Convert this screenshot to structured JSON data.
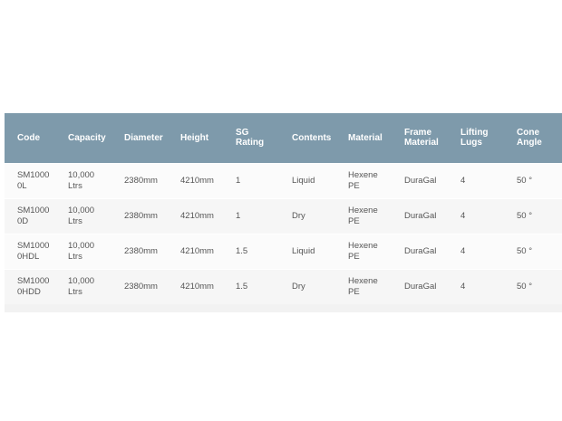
{
  "table": {
    "headers": [
      [
        "Code"
      ],
      [
        "Capacity"
      ],
      [
        "Diameter"
      ],
      [
        "Height"
      ],
      [
        "SG",
        "Rating"
      ],
      [
        "Contents"
      ],
      [
        "Material"
      ],
      [
        "Frame",
        "Material"
      ],
      [
        "Lifting",
        "Lugs"
      ],
      [
        "Cone",
        "Angle"
      ]
    ],
    "rows": [
      [
        [
          "SM1000",
          "0L"
        ],
        [
          "10,000",
          "Ltrs"
        ],
        [
          "2380mm"
        ],
        [
          "4210mm"
        ],
        [
          "1"
        ],
        [
          "Liquid"
        ],
        [
          "Hexene",
          "PE"
        ],
        [
          "DuraGal"
        ],
        [
          "4"
        ],
        [
          "50 °"
        ]
      ],
      [
        [
          "SM1000",
          "0D"
        ],
        [
          "10,000",
          "Ltrs"
        ],
        [
          "2380mm"
        ],
        [
          "4210mm"
        ],
        [
          "1"
        ],
        [
          "Dry"
        ],
        [
          "Hexene",
          "PE"
        ],
        [
          "DuraGal"
        ],
        [
          "4"
        ],
        [
          "50 °"
        ]
      ],
      [
        [
          "SM1000",
          "0HDL"
        ],
        [
          "10,000",
          "Ltrs"
        ],
        [
          "2380mm"
        ],
        [
          "4210mm"
        ],
        [
          "1.5"
        ],
        [
          "Liquid"
        ],
        [
          "Hexene",
          "PE"
        ],
        [
          "DuraGal"
        ],
        [
          "4"
        ],
        [
          "50 °"
        ]
      ],
      [
        [
          "SM1000",
          "0HDD"
        ],
        [
          "10,000",
          "Ltrs"
        ],
        [
          "2380mm"
        ],
        [
          "4210mm"
        ],
        [
          "1.5"
        ],
        [
          "Dry"
        ],
        [
          "Hexene",
          "PE"
        ],
        [
          "DuraGal"
        ],
        [
          "4"
        ],
        [
          "50 °"
        ]
      ]
    ]
  },
  "colors": {
    "header_bg": "#7e9aab",
    "header_text": "#ffffff",
    "body_text": "#555555"
  }
}
